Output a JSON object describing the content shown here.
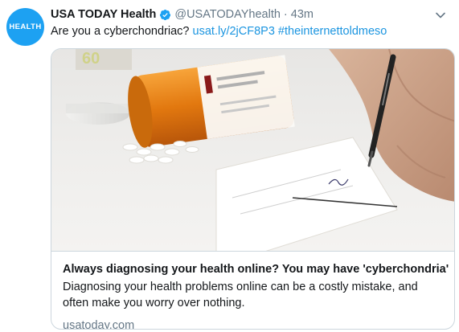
{
  "tweet": {
    "avatar_text": "HEALTH",
    "display_name": "USA TODAY Health",
    "handle": "@USATODAYhealth",
    "separator": "·",
    "time": "43m",
    "text_plain": "Are you a cyberchondriac?",
    "link_text": "usat.ly/2jCF8P3",
    "hashtag": "#theinternettoldmeso"
  },
  "card": {
    "image_icon": "prescription-pills-photo",
    "title": "Always diagnosing your health online? You may have 'cyberchondria'",
    "description": "Diagnosing your health problems online can be a costly mistake, and often make you worry over nothing.",
    "domain": "usatoday.com"
  },
  "colors": {
    "brand_blue": "#1da1f2",
    "link_blue": "#1b95e0",
    "muted_gray": "#657786",
    "border": "#ccd6dd"
  }
}
